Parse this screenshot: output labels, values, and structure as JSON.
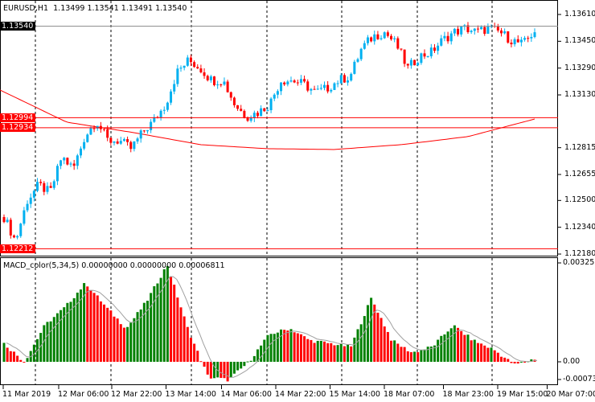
{
  "header": {
    "symbol": "EURUSD,H1",
    "open": "1.13499",
    "high": "1.13541",
    "low": "1.13491",
    "close": "1.13540"
  },
  "indicator": {
    "name": "MACD_color(5,34,5)",
    "v1": "0.00000000",
    "v2": "0.00000000",
    "v3": "0.00006811"
  },
  "price_axis": [
    "1.13610",
    "1.13450",
    "1.13290",
    "1.13130",
    "1.12815",
    "1.12655",
    "1.12500",
    "1.12340",
    "1.12180"
  ],
  "price_tags": [
    {
      "text": "1.13540",
      "price": 1.1354,
      "color": "#000000",
      "line": "#8a8a8a"
    },
    {
      "text": "1.12994",
      "price": 1.12994,
      "color": "#ff0000",
      "line": "#ff0000"
    },
    {
      "text": "1.12934",
      "price": 1.12934,
      "color": "#ff0000",
      "line": "#ff0000"
    },
    {
      "text": "1.12212",
      "price": 1.12212,
      "color": "#ff0000",
      "line": "#ff0000"
    }
  ],
  "macd_axis": {
    "top": "0.0032551",
    "zero": "0.00",
    "bottom": "-0.000732"
  },
  "time_axis": [
    "11 Mar 2019",
    "12 Mar 06:00",
    "12 Mar 22:00",
    "13 Mar 14:00",
    "14 Mar 06:00",
    "14 Mar 22:00",
    "15 Mar 14:00",
    "18 Mar 07:00",
    "18 Mar 23:00",
    "19 Mar 15:00",
    "20 Mar 07:00"
  ],
  "colors": {
    "bull": "#00b0f0",
    "bear": "#ff0000",
    "ma": "#ff0000",
    "hist_up": "#008000",
    "hist_down": "#ff0000",
    "signal": "#a0a0a0"
  },
  "price_path": [
    1.12401,
    1.12257,
    1.12497,
    1.12593,
    1.12545,
    1.12761,
    1.12689,
    1.12881,
    1.12977,
    1.12857,
    1.12857,
    1.12809,
    1.12905,
    1.12977,
    1.13073,
    1.13265,
    1.13337,
    1.13289,
    1.13217,
    1.13217,
    1.13073,
    1.13001,
    1.13025,
    1.13073,
    1.13217,
    1.13217,
    1.13193,
    1.13145,
    1.13169,
    1.13217,
    1.13241,
    1.13408,
    1.1348,
    1.13504,
    1.13432,
    1.13289,
    1.1336,
    1.13384,
    1.13456,
    1.13504,
    1.13528,
    1.13504,
    1.13528,
    1.13504,
    1.13456,
    1.13432,
    1.13514
  ],
  "ma_path": [
    1.13159,
    1.12967,
    1.12905,
    1.12833,
    1.12809,
    1.12804,
    1.12833,
    1.12881,
    1.12986
  ],
  "macd_path": [
    0.0006,
    0.0,
    0.0012,
    0.0018,
    0.0026,
    0.0018,
    0.0011,
    0.002,
    0.0032,
    0.0011,
    -0.0005,
    -0.0006,
    0.0,
    0.0009,
    0.0011,
    0.0007,
    0.0006,
    0.0005,
    0.0021,
    0.0007,
    0.0003,
    0.0005,
    0.0012,
    0.0007,
    0.0004,
    -0.0001,
    0.0001
  ]
}
